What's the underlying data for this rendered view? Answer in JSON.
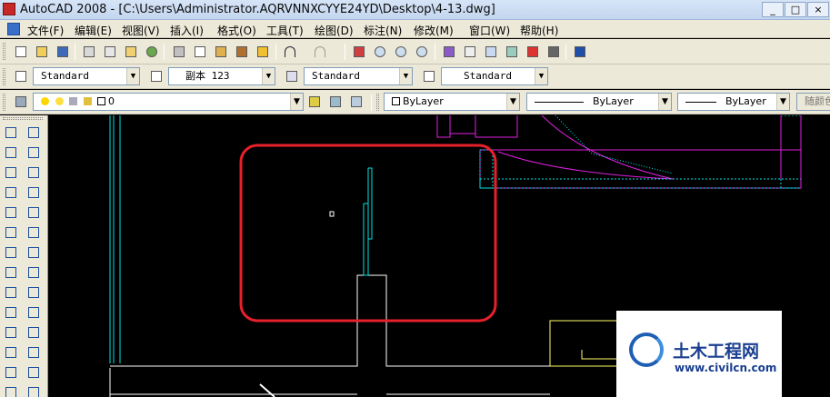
{
  "window": {
    "title": "AutoCAD 2008 - [C:\\Users\\Administrator.AQRVNNXCYYE24YD\\Desktop\\4-13.dwg]",
    "controls": [
      "_",
      "□",
      "×"
    ]
  },
  "menu": {
    "items": [
      "文件(F)",
      "编辑(E)",
      "视图(V)",
      "插入(I)",
      "格式(O)",
      "工具(T)",
      "绘图(D)",
      "标注(N)",
      "修改(M)",
      "窗口(W)",
      "帮助(H)"
    ]
  },
  "styles_toolbar": {
    "text_style": "Standard",
    "dim_style": "副本 123",
    "table_style": "Standard",
    "multileader_style": "Standard"
  },
  "layers_toolbar": {
    "current_layer": "0",
    "color": "ByLayer",
    "linetype": "ByLayer",
    "lineweight": "ByLayer",
    "plot_style": "随颜色"
  },
  "icons": {
    "standard_toolbar": [
      "new-icon",
      "open-icon",
      "save-icon",
      "plot-icon",
      "plot-preview-icon",
      "publish-icon",
      "3d-dwf-icon",
      "cut-icon",
      "copy-icon",
      "paste-icon",
      "match-properties-icon",
      "block-editor-icon",
      "undo-icon",
      "redo-icon",
      "pan-icon",
      "zoom-realtime-icon",
      "zoom-window-icon",
      "zoom-previous-icon",
      "properties-icon",
      "design-center-icon",
      "tool-palettes-icon",
      "sheet-set-icon",
      "markup-icon",
      "quickcalc-icon",
      "help-icon"
    ],
    "draw_column": [
      "line-icon",
      "construction-line-icon",
      "polyline-icon",
      "polygon-icon",
      "rectangle-icon",
      "arc-icon",
      "circle-icon",
      "revision-cloud-icon",
      "spline-icon",
      "ellipse-icon",
      "ellipse-arc-icon",
      "insert-block-icon",
      "make-block-icon",
      "point-icon"
    ],
    "modify_column": [
      "erase-icon",
      "copy-object-icon",
      "mirror-icon",
      "offset-icon",
      "array-icon",
      "move-icon",
      "rotate-icon",
      "scale-icon",
      "stretch-icon",
      "trim-icon",
      "extend-icon",
      "break-icon",
      "chamfer-icon",
      "fillet-icon"
    ]
  },
  "colors": {
    "canvas": "#000000",
    "cyan": "#00e5e5",
    "magenta": "#e020e0",
    "yellow": "#ffff66",
    "white": "#ffffff",
    "highlight": "#e8202a"
  },
  "watermark": {
    "title": "土木工程网",
    "url": "www.civilcn.com"
  }
}
